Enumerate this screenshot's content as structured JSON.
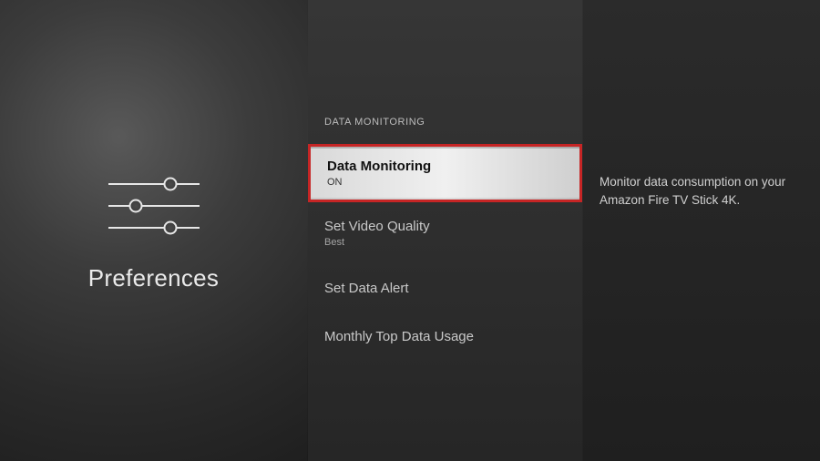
{
  "left": {
    "title": "Preferences"
  },
  "section": {
    "header": "DATA MONITORING"
  },
  "menu": {
    "item0": {
      "title": "Data Monitoring",
      "sub": "ON"
    },
    "item1": {
      "title": "Set Video Quality",
      "sub": "Best"
    },
    "item2": {
      "title": "Set Data Alert"
    },
    "item3": {
      "title": "Monthly Top Data Usage"
    }
  },
  "description": {
    "text": "Monitor data consumption on your Amazon Fire TV Stick 4K."
  }
}
